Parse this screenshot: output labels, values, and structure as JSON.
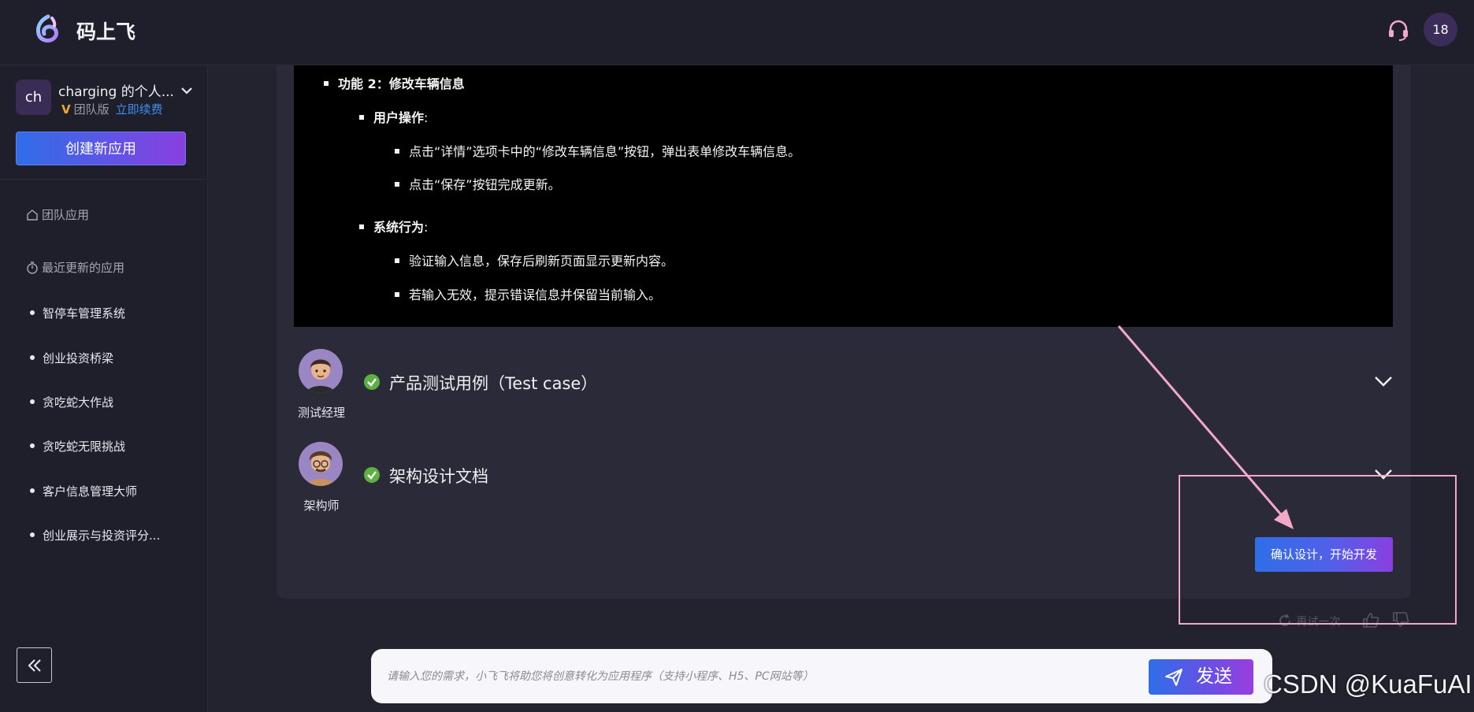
{
  "header": {
    "brand": "码上飞",
    "user_badge": "18",
    "colors": {
      "bg": "#1f1f2b",
      "accent": "#5b56e6"
    }
  },
  "sidebar": {
    "workspace": {
      "avatar": "ch",
      "name": "charging 的个人...",
      "plan_label": "团队版",
      "renew_label": "立即续费"
    },
    "create_label": "创建新应用",
    "nav": {
      "team_apps": "团队应用",
      "recent": "最近更新的应用"
    },
    "recent_apps": [
      "智停车管理系统",
      "创业投资桥梁",
      "贪吃蛇大作战",
      "贪吃蛇无限挑战",
      "客户信息管理大师",
      "创业展示与投资评分..."
    ]
  },
  "doc": {
    "feature_title": "功能 2：修改车辆信息",
    "user_ops_title": "用户操作",
    "user_ops": [
      "点击“详情”选项卡中的“修改车辆信息”按钮，弹出表单修改车辆信息。",
      "点击“保存”按钮完成更新。"
    ],
    "system_title": "系统行为",
    "system": [
      "验证输入信息，保存后刷新页面显示更新内容。",
      "若输入无效，提示错误信息并保留当前输入。"
    ]
  },
  "sections": [
    {
      "role": "测试经理",
      "title": "产品测试用例（Test case）",
      "status": "done"
    },
    {
      "role": "架构师",
      "title": "架构设计文档",
      "status": "done"
    }
  ],
  "confirm_label": "确认设计，开始开发",
  "feedback": {
    "retry_label": "再试一次"
  },
  "prompt": {
    "placeholder": "请输入您的需求，小飞飞将助您将创意转化为应用程序（支持小程序、H5、PC网站等）",
    "send_label": "发送"
  },
  "watermark": "CSDN @KuaFuAI"
}
